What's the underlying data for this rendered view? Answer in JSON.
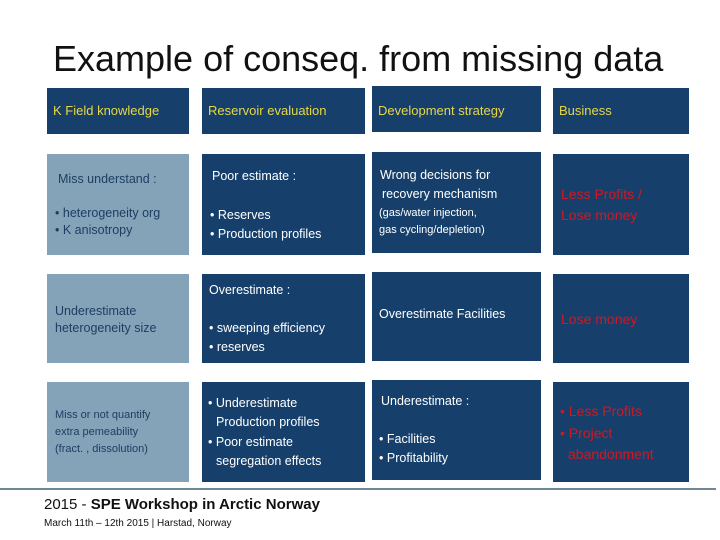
{
  "slide": {
    "title": "Example of conseq. from missing data",
    "headers": [
      "K Field knowledge",
      "Reservoir evaluation",
      "Development strategy",
      "Business"
    ],
    "rows": [
      {
        "knowledge": {
          "heading": "Miss understand :",
          "bullets": [
            "heterogeneity org",
            "K anisotropy"
          ]
        },
        "reservoir": {
          "heading": "Poor estimate :",
          "bullets": [
            "Reserves",
            "Production profiles"
          ]
        },
        "development": {
          "line1": "Wrong decisions for",
          "line2": "recovery mechanism",
          "line3": "(gas/water injection,",
          "line4": "gas cycling/depletion)"
        },
        "business": {
          "line1": "Less Profits /",
          "line2": "Lose money"
        }
      },
      {
        "knowledge": {
          "line1": "Underestimate",
          "line2": "heterogeneity size"
        },
        "reservoir": {
          "heading": "Overestimate :",
          "bullets": [
            "sweeping efficiency",
            "reserves"
          ]
        },
        "development": {
          "line1": "Overestimate Facilities"
        },
        "business": {
          "line1": "Lose money"
        }
      },
      {
        "knowledge": {
          "line1": "Miss or not quantify",
          "line2": "extra pemeability",
          "line3": "(fract. , dissolution)"
        },
        "reservoir": {
          "bullet1_a": "Underestimate",
          "bullet1_b": "Production profiles",
          "bullet2_a": "Poor estimate",
          "bullet2_b": "segregation effects"
        },
        "development": {
          "heading": "Underestimate :",
          "bullets": [
            "Facilities",
            "Profitability"
          ]
        },
        "business": {
          "bullet1": "Less Profits",
          "bullet2_a": "Project",
          "bullet2_b": "abandonment"
        }
      }
    ],
    "bullet_glyph": "•"
  },
  "footer": {
    "year_prefix": "2015 - ",
    "event": "SPE Workshop in Arctic Norway",
    "details": "March 11th – 12th 2015 | Harstad, Norway"
  },
  "colors": {
    "box_dark": "#16406b",
    "box_light": "#84a3b8",
    "header_text": "#e8d646",
    "business_text": "#d41620"
  }
}
